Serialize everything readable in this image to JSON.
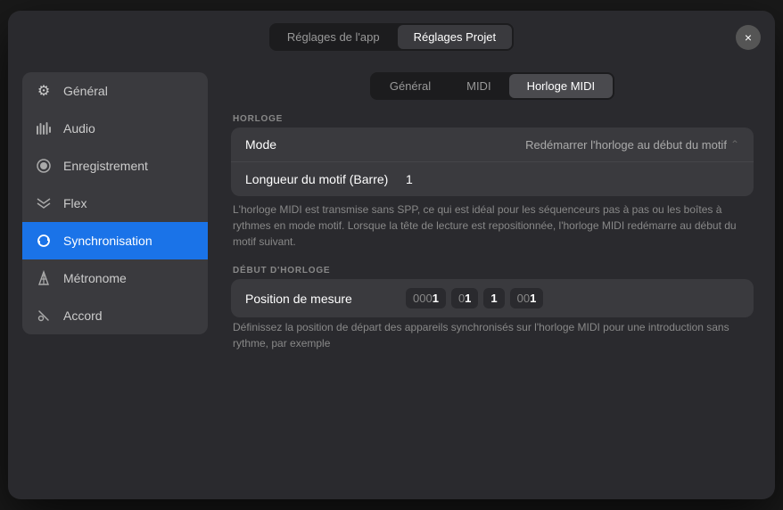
{
  "modal": {
    "header": {
      "tab_app_label": "Réglages de l'app",
      "tab_project_label": "Réglages Projet",
      "active_tab": "project",
      "close_icon": "×"
    },
    "sidebar": {
      "items": [
        {
          "id": "general",
          "icon": "⚙",
          "label": "Général",
          "active": false
        },
        {
          "id": "audio",
          "icon": "📊",
          "label": "Audio",
          "active": false
        },
        {
          "id": "enregistrement",
          "icon": "⏺",
          "label": "Enregistrement",
          "active": false
        },
        {
          "id": "flex",
          "icon": "⊠",
          "label": "Flex",
          "active": false
        },
        {
          "id": "synchronisation",
          "icon": "↻",
          "label": "Synchronisation",
          "active": true
        },
        {
          "id": "metronome",
          "icon": "🔔",
          "label": "Métronome",
          "active": false
        },
        {
          "id": "accord",
          "icon": "✏",
          "label": "Accord",
          "active": false
        }
      ]
    },
    "content": {
      "tabs": [
        {
          "id": "general",
          "label": "Général",
          "active": false
        },
        {
          "id": "midi",
          "label": "MIDI",
          "active": false
        },
        {
          "id": "horloge_midi",
          "label": "Horloge MIDI",
          "active": true
        }
      ],
      "horloge_section_label": "HORLOGE",
      "mode_label": "Mode",
      "mode_value": "Redémarrer l'horloge au début du motif",
      "mode_stepper": "◇",
      "longueur_label": "Longueur du motif (Barre)",
      "longueur_value": "1",
      "description1": "L'horloge MIDI est transmise sans SPP, ce qui est idéal pour les séquenceurs pas à pas ou les boîtes à rythmes en mode motif. Lorsque la tête de lecture est repositionnée, l'horloge MIDI redémarre au début du motif suivant.",
      "debut_section_label": "DÉBUT D'HORLOGE",
      "position_label": "Position de mesure",
      "position_fields": [
        {
          "prefix": "000",
          "value": "1"
        },
        {
          "prefix": "0",
          "value": "1"
        },
        {
          "prefix": "",
          "value": "1"
        },
        {
          "prefix": "00",
          "value": "1"
        }
      ],
      "description2": "Définissez la position de départ des appareils synchronisés sur l'horloge MIDI pour une introduction sans rythme, par exemple"
    }
  }
}
